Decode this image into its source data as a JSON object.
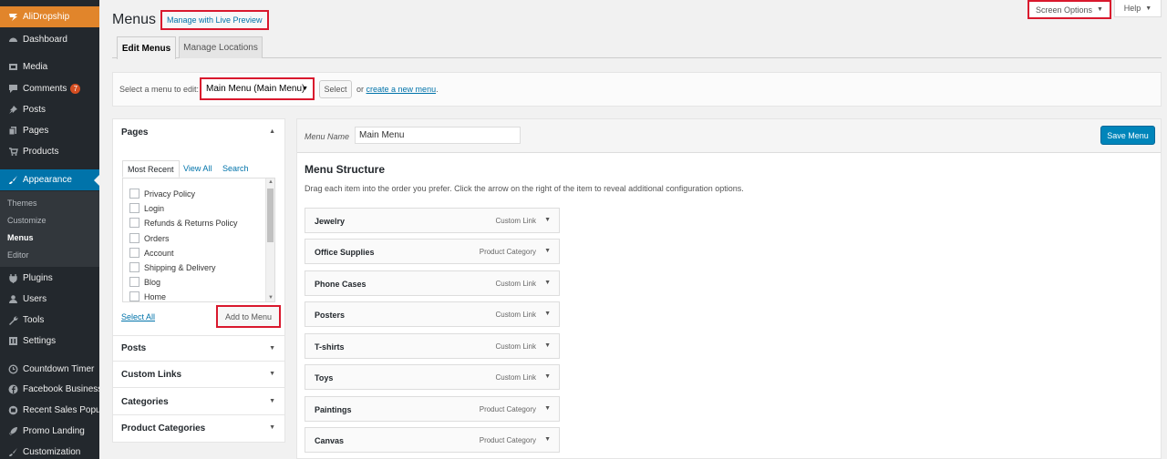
{
  "sidebar": {
    "brand": {
      "label": "AliDropship",
      "icon": "alidropship-icon"
    },
    "items": [
      {
        "label": "Dashboard",
        "icon": "dashboard-icon"
      },
      {
        "label": "Media",
        "icon": "media-icon"
      },
      {
        "label": "Comments",
        "icon": "comments-icon",
        "badge": "7"
      },
      {
        "label": "Posts",
        "icon": "pin-icon"
      },
      {
        "label": "Pages",
        "icon": "pages-icon"
      },
      {
        "label": "Products",
        "icon": "cart-icon"
      },
      {
        "label": "Appearance",
        "icon": "brush-icon"
      },
      {
        "label": "Plugins",
        "icon": "plugin-icon"
      },
      {
        "label": "Users",
        "icon": "users-icon"
      },
      {
        "label": "Tools",
        "icon": "wrench-icon"
      },
      {
        "label": "Settings",
        "icon": "settings-icon"
      },
      {
        "label": "Countdown Timer",
        "icon": "clock-icon"
      },
      {
        "label": "Facebook Business",
        "icon": "facebook-icon"
      },
      {
        "label": "Recent Sales Popup",
        "icon": "popup-icon"
      },
      {
        "label": "Promo Landing",
        "icon": "rocket-icon"
      },
      {
        "label": "Customization",
        "icon": "customization-icon"
      }
    ],
    "submenu": [
      "Themes",
      "Customize",
      "Menus",
      "Editor"
    ]
  },
  "header": {
    "title": "Menus",
    "live_preview": "Manage with Live Preview",
    "screen_options": "Screen Options",
    "help": "Help"
  },
  "tabs": [
    "Edit Menus",
    "Manage Locations"
  ],
  "manage": {
    "label": "Select a menu to edit:",
    "selected": "Main Menu (Main Menu)",
    "select_button": "Select",
    "or_text": "or",
    "create_link": "create a new menu",
    "period": "."
  },
  "pages_panel": {
    "title": "Pages",
    "tabs": [
      "Most Recent",
      "View All",
      "Search"
    ],
    "items": [
      "Privacy Policy",
      "Login",
      "Refunds & Returns Policy",
      "Orders",
      "Account",
      "Shipping & Delivery",
      "Blog",
      "Home"
    ],
    "select_all": "Select All",
    "add_button": "Add to Menu"
  },
  "accordions": [
    "Posts",
    "Custom Links",
    "Categories",
    "Product Categories"
  ],
  "menu_editor": {
    "name_label": "Menu Name",
    "name_value": "Main Menu",
    "save_button": "Save Menu",
    "structure_title": "Menu Structure",
    "structure_desc": "Drag each item into the order you prefer. Click the arrow on the right of the item to reveal additional configuration options.",
    "items": [
      {
        "title": "Jewelry",
        "type": "Custom Link"
      },
      {
        "title": "Office Supplies",
        "type": "Product Category"
      },
      {
        "title": "Phone Cases",
        "type": "Custom Link"
      },
      {
        "title": "Posters",
        "type": "Custom Link"
      },
      {
        "title": "T-shirts",
        "type": "Custom Link"
      },
      {
        "title": "Toys",
        "type": "Custom Link"
      },
      {
        "title": "Paintings",
        "type": "Product Category"
      },
      {
        "title": "Canvas",
        "type": "Product Category"
      }
    ]
  },
  "colors": {
    "accent": "#0073aa",
    "highlight_box": "#d9182d",
    "brand": "#e1852b",
    "sidebar": "#23282d"
  }
}
